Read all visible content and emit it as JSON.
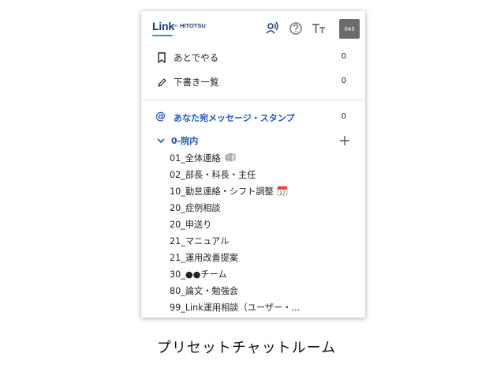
{
  "header": {
    "logo_main": "Link",
    "logo_by": "by",
    "logo_sub": "HITOTSU",
    "avatar_text": "045"
  },
  "lists": [
    {
      "label": "あとでやる",
      "count": "0",
      "icon": "bookmark-icon"
    },
    {
      "label": "下書き一覧",
      "count": "0",
      "icon": "pencil-icon"
    }
  ],
  "mentions": {
    "label": "あなた宛メッセージ・スタンプ",
    "count": "0",
    "icon": "at-icon"
  },
  "group": {
    "label": "0-院内",
    "icon": "chevron-down-icon",
    "add_icon": "plus-icon"
  },
  "rooms": [
    {
      "label": "01_全体連絡",
      "emoji": "megaphone-icon"
    },
    {
      "label": "02_部長・科長・主任"
    },
    {
      "label": "10_勤怠連絡・シフト調整",
      "emoji": "calendar-icon"
    },
    {
      "label": "20_症例相談"
    },
    {
      "label": "20_申送り"
    },
    {
      "label": "21_マニュアル"
    },
    {
      "label": "21_運用改善提案"
    },
    {
      "label": "30_●●チーム"
    },
    {
      "label": "80_論文・勉強会"
    },
    {
      "label": "99_Link運用相談（ユーザー・..."
    }
  ],
  "caption": "プリセットチャットルーム",
  "colors": {
    "accent": "#1f57b5",
    "logo": "#1f3b78",
    "avatar_bg": "#6b6b6b"
  }
}
